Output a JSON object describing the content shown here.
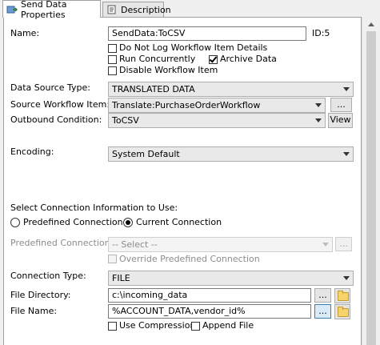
{
  "tabs": [
    {
      "label": "Send Data Properties",
      "icon": "send-data-icon",
      "active": true
    },
    {
      "label": "Description",
      "icon": "description-icon",
      "active": false
    }
  ],
  "form": {
    "name_label": "Name:",
    "name_value": "SendData:ToCSV",
    "id_label": "ID:5",
    "options": {
      "do_not_log": "Do Not Log Workflow Item Details",
      "run_concurrently": "Run Concurrently",
      "archive_data": "Archive Data",
      "disable_workflow_item": "Disable Workflow Item"
    },
    "data_source_type_label": "Data Source Type:",
    "data_source_type_value": "TRANSLATED DATA",
    "source_workflow_item_label": "Source Workflow Item:",
    "source_workflow_item_value": "Translate:PurchaseOrderWorkflow",
    "outbound_condition_label": "Outbound Condition:",
    "outbound_condition_value": "ToCSV",
    "browse_label": "...",
    "view_label": "View",
    "encoding_label": "Encoding:",
    "encoding_value": "System Default",
    "connection_info_label": "Select Connection Information to Use:",
    "radio_predefined": "Predefined Connection",
    "radio_current": "Current Connection",
    "predefined_connection_label": "Predefined Connection:",
    "predefined_connection_value": "-- Select --",
    "override_predefined": "Override Predefined Connection",
    "connection_type_label": "Connection Type:",
    "connection_type_value": "FILE",
    "file_directory_label": "File Directory:",
    "file_directory_value": "c:\\incoming_data",
    "file_name_label": "File Name:",
    "file_name_value": "%ACCOUNT_DATA,vendor_id%",
    "use_compression": "Use Compression",
    "append_file": "Append File"
  },
  "state": {
    "do_not_log": false,
    "run_concurrently": false,
    "archive_data": true,
    "disable_workflow_item": false,
    "connection_mode": "Current Connection",
    "override_predefined": false,
    "use_compression": false,
    "append_file": false
  }
}
